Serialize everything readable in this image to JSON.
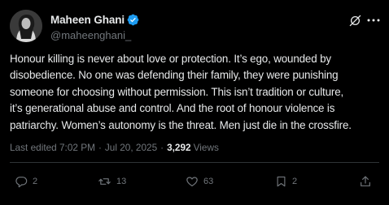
{
  "author": {
    "display_name": "Maheen Ghani",
    "handle": "@maheenghani_",
    "verified": true,
    "avatar_icon": "profile-photo"
  },
  "tweet": {
    "text": "Honour killing is never about love or protection. It’s ego, wounded by\ndisobedience. No one was defending their family, they were punishing\nsomeone for choosing without permission. This isn’t tradition or culture,\nit’s generational abuse and control. And the root of honour violence is\npatriarchy. Women’s autonomy is the threat. Men just die in the crossfire."
  },
  "meta": {
    "edited_label": "Last edited 7:02 PM",
    "separator": "·",
    "date": "Jul 20, 2025",
    "views_count": "3,292",
    "views_label": "Views"
  },
  "actions": {
    "replies": "2",
    "reposts": "13",
    "likes": "63",
    "bookmarks": "2"
  },
  "colors": {
    "background": "#000000",
    "text_primary": "#e7e9ea",
    "text_secondary": "#71767b",
    "verified_badge": "#1d9bf0",
    "divider": "#2f3336"
  }
}
